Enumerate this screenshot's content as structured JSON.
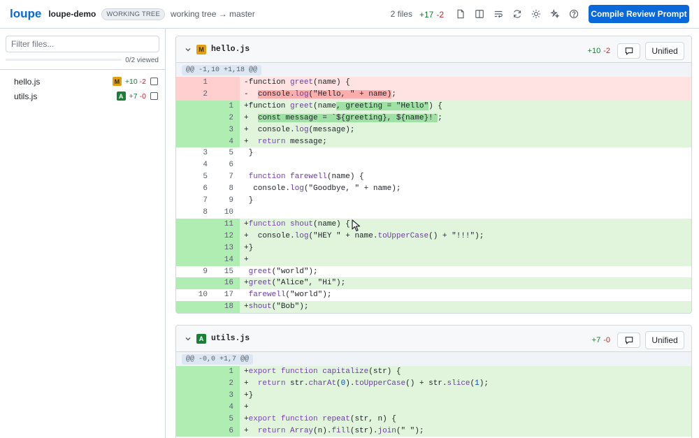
{
  "header": {
    "logo": "loupe",
    "repo": "loupe-demo",
    "mode_badge": "WORKING TREE",
    "branch": "working tree → master",
    "files_count": "2 files",
    "additions": "+17",
    "deletions": "-2",
    "primary_button": "Compile Review Prompt",
    "icons": [
      "file-icon",
      "split-view-icon",
      "wrap-icon",
      "refresh-icon",
      "theme-icon",
      "sparkle-icon",
      "help-icon"
    ]
  },
  "sidebar": {
    "filter_placeholder": "Filter files...",
    "viewed_text": "0/2 viewed",
    "viewed_fraction": 0,
    "files": [
      {
        "name": "hello.js",
        "status": "M",
        "add": "+10",
        "del": "-2"
      },
      {
        "name": "utils.js",
        "status": "A",
        "add": "+7",
        "del": "-0"
      }
    ]
  },
  "diffs": [
    {
      "file": "hello.js",
      "status": "M",
      "add": "+10",
      "del": "-2",
      "mode": "Unified",
      "hunk": "@@ -1,10 +1,18 @@",
      "lines": [
        {
          "type": "del",
          "old": "1",
          "new": "",
          "html": "-function <span class=\"fn\">greet</span>(name) {"
        },
        {
          "type": "del",
          "old": "2",
          "new": "",
          "html": "-  <span class=\"hl-del\">console.<span class=\"fn\">log</span>(\"Hello, \" + name)</span>;"
        },
        {
          "type": "add",
          "old": "",
          "new": "1",
          "html": "+function <span class=\"fn\">greet</span>(name<span class=\"hl-add\">, greeting = \"Hello\"</span>) {"
        },
        {
          "type": "add",
          "old": "",
          "new": "2",
          "html": "+  <span class=\"hl-add\">const message = `${greeting}, ${name}!`</span>;"
        },
        {
          "type": "add",
          "old": "",
          "new": "3",
          "html": "+  console.<span class=\"fn\">log</span>(message);"
        },
        {
          "type": "add",
          "old": "",
          "new": "4",
          "html": "+  <span class=\"kw\">return</span> message;"
        },
        {
          "type": "ctx",
          "old": "3",
          "new": "5",
          "html": " }"
        },
        {
          "type": "ctx",
          "old": "4",
          "new": "6",
          "html": " "
        },
        {
          "type": "ctx",
          "old": "5",
          "new": "7",
          "html": " <span class=\"kw\">function</span> <span class=\"fn\">farewell</span>(name) {"
        },
        {
          "type": "ctx",
          "old": "6",
          "new": "8",
          "html": "  console.<span class=\"fn\">log</span>(\"Goodbye, \" + name);"
        },
        {
          "type": "ctx",
          "old": "7",
          "new": "9",
          "html": " }"
        },
        {
          "type": "ctx",
          "old": "8",
          "new": "10",
          "html": " "
        },
        {
          "type": "add",
          "old": "",
          "new": "11",
          "html": "+<span class=\"kw\">function</span> <span class=\"fn\">shout</span>(name) {"
        },
        {
          "type": "add",
          "old": "",
          "new": "12",
          "html": "+  console.<span class=\"fn\">log</span>(\"HEY \" + name.<span class=\"fn\">toUpperCase</span>() + \"!!!\");"
        },
        {
          "type": "add",
          "old": "",
          "new": "13",
          "html": "+}"
        },
        {
          "type": "add",
          "old": "",
          "new": "14",
          "html": "+"
        },
        {
          "type": "ctx",
          "old": "9",
          "new": "15",
          "html": " <span class=\"fn\">greet</span>(\"world\");"
        },
        {
          "type": "add",
          "old": "",
          "new": "16",
          "html": "+<span class=\"fn\">greet</span>(\"Alice\", \"Hi\");"
        },
        {
          "type": "ctx",
          "old": "10",
          "new": "17",
          "html": " <span class=\"fn\">farewell</span>(\"world\");"
        },
        {
          "type": "add",
          "old": "",
          "new": "18",
          "html": "+<span class=\"fn\">shout</span>(\"Bob\");"
        }
      ]
    },
    {
      "file": "utils.js",
      "status": "A",
      "add": "+7",
      "del": "-0",
      "mode": "Unified",
      "hunk": "@@ -0,0 +1,7 @@",
      "lines": [
        {
          "type": "add",
          "old": "",
          "new": "1",
          "html": "+<span class=\"kw\">export</span> <span class=\"kw\">function</span> <span class=\"fn\">capitalize</span>(str) {"
        },
        {
          "type": "add",
          "old": "",
          "new": "2",
          "html": "+  <span class=\"kw\">return</span> str.<span class=\"fn\">charAt</span>(<span class=\"num\">0</span>).<span class=\"fn\">toUpperCase</span>() + str.<span class=\"fn\">slice</span>(<span class=\"num\">1</span>);"
        },
        {
          "type": "add",
          "old": "",
          "new": "3",
          "html": "+}"
        },
        {
          "type": "add",
          "old": "",
          "new": "4",
          "html": "+"
        },
        {
          "type": "add",
          "old": "",
          "new": "5",
          "html": "+<span class=\"kw\">export</span> <span class=\"kw\">function</span> <span class=\"fn\">repeat</span>(str, n) {"
        },
        {
          "type": "add",
          "old": "",
          "new": "6",
          "html": "+  <span class=\"kw\">return</span> <span class=\"fn\">Array</span>(n).<span class=\"fn\">fill</span>(str).<span class=\"fn\">join</span>(\" \");"
        }
      ]
    }
  ]
}
